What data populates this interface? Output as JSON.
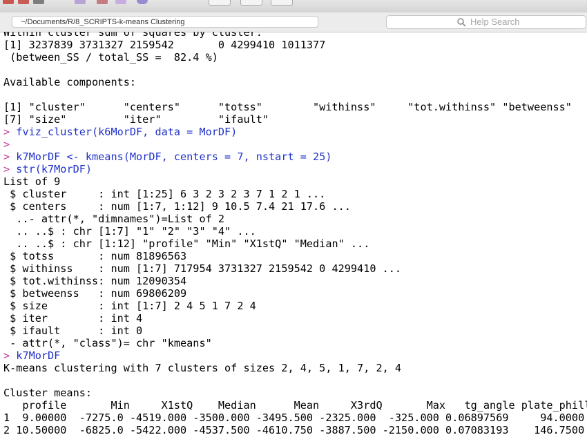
{
  "toolbar": {
    "icons": [
      "toolbar-button-icon",
      "toolbar-button-icon",
      "toolbar-button-icon"
    ]
  },
  "pathbar": {
    "path": "~/Documents/R/8_SCRIPTS-k-means Clustering"
  },
  "search": {
    "placeholder": "Help Search",
    "icon": "search-icon"
  },
  "colors": {
    "prompt": "#c13b99",
    "command": "#1f31c8",
    "output": "#000000"
  },
  "console": {
    "lines": [
      {
        "type": "output",
        "text": "Within cluster sum of squares by cluster:"
      },
      {
        "type": "output",
        "text": "[1] 3237839 3731327 2159542       0 4299410 1011377"
      },
      {
        "type": "output",
        "text": " (between_SS / total_SS =  82.4 %)"
      },
      {
        "type": "output",
        "text": ""
      },
      {
        "type": "output",
        "text": "Available components:"
      },
      {
        "type": "output",
        "text": ""
      },
      {
        "type": "output",
        "text": "[1] \"cluster\"      \"centers\"      \"totss\"        \"withinss\"     \"tot.withinss\" \"betweenss\""
      },
      {
        "type": "output",
        "text": "[7] \"size\"         \"iter\"         \"ifault\""
      },
      {
        "type": "command",
        "prompt": "> ",
        "text": "fviz_cluster(k6MorDF, data = MorDF)"
      },
      {
        "type": "command",
        "prompt": ">",
        "text": ""
      },
      {
        "type": "command",
        "prompt": "> ",
        "text": "k7MorDF <- kmeans(MorDF, centers = 7, nstart = 25)"
      },
      {
        "type": "command",
        "prompt": "> ",
        "text": "str(k7MorDF)"
      },
      {
        "type": "output",
        "text": "List of 9"
      },
      {
        "type": "output",
        "text": " $ cluster     : int [1:25] 6 3 2 3 2 3 7 1 2 1 ..."
      },
      {
        "type": "output",
        "text": " $ centers     : num [1:7, 1:12] 9 10.5 7.4 21 17.6 ..."
      },
      {
        "type": "output",
        "text": "  ..- attr(*, \"dimnames\")=List of 2"
      },
      {
        "type": "output",
        "text": "  .. ..$ : chr [1:7] \"1\" \"2\" \"3\" \"4\" ..."
      },
      {
        "type": "output",
        "text": "  .. ..$ : chr [1:12] \"profile\" \"Min\" \"X1stQ\" \"Median\" ..."
      },
      {
        "type": "output",
        "text": " $ totss       : num 81896563"
      },
      {
        "type": "output",
        "text": " $ withinss    : num [1:7] 717954 3731327 2159542 0 4299410 ..."
      },
      {
        "type": "output",
        "text": " $ tot.withinss: num 12090354"
      },
      {
        "type": "output",
        "text": " $ betweenss   : num 69806209"
      },
      {
        "type": "output",
        "text": " $ size        : int [1:7] 2 4 5 1 7 2 4"
      },
      {
        "type": "output",
        "text": " $ iter        : int 4"
      },
      {
        "type": "output",
        "text": " $ ifault      : int 0"
      },
      {
        "type": "output",
        "text": " - attr(*, \"class\")= chr \"kmeans\""
      },
      {
        "type": "command",
        "prompt": "> ",
        "text": "k7MorDF"
      },
      {
        "type": "output",
        "text": "K-means clustering with 7 clusters of sizes 2, 4, 5, 1, 7, 2, 4"
      },
      {
        "type": "output",
        "text": ""
      },
      {
        "type": "output",
        "text": "Cluster means:"
      },
      {
        "type": "output",
        "text": "   profile       Min     X1stQ    Median      Mean     X3rdQ       Max   tg_angle plate_phill"
      },
      {
        "type": "output",
        "text": "1  9.00000  -7275.0 -4519.000 -3500.000 -3495.500 -2325.000  -325.000 0.06897569     94.0000"
      },
      {
        "type": "output",
        "text": "2 10.50000  -6825.0 -5422.000 -4537.500 -4610.750 -3887.500 -2150.000 0.07083193    146.7500"
      }
    ]
  }
}
